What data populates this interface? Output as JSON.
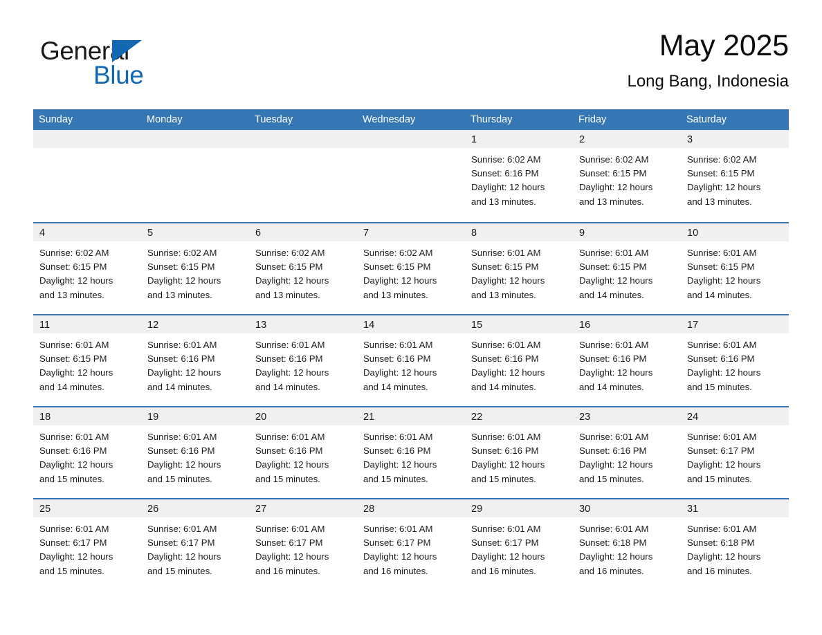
{
  "brand": {
    "name_part1": "General",
    "name_part2": "Blue",
    "triangle_color": "#1268b3",
    "text_color": "#1a1a1a"
  },
  "header": {
    "title": "May 2025",
    "subtitle": "Long Bang, Indonesia"
  },
  "theme": {
    "header_blue": "#3577b5",
    "band_gray": "#f0f0f0",
    "text": "#1a1a1a"
  },
  "calendar": {
    "weekdays": [
      "Sunday",
      "Monday",
      "Tuesday",
      "Wednesday",
      "Thursday",
      "Friday",
      "Saturday"
    ],
    "weeks": [
      [
        {
          "day": "",
          "sunrise": "",
          "sunset": "",
          "daylight_line1": "",
          "daylight_line2": ""
        },
        {
          "day": "",
          "sunrise": "",
          "sunset": "",
          "daylight_line1": "",
          "daylight_line2": ""
        },
        {
          "day": "",
          "sunrise": "",
          "sunset": "",
          "daylight_line1": "",
          "daylight_line2": ""
        },
        {
          "day": "",
          "sunrise": "",
          "sunset": "",
          "daylight_line1": "",
          "daylight_line2": ""
        },
        {
          "day": "1",
          "sunrise": "Sunrise: 6:02 AM",
          "sunset": "Sunset: 6:16 PM",
          "daylight_line1": "Daylight: 12 hours",
          "daylight_line2": "and 13 minutes."
        },
        {
          "day": "2",
          "sunrise": "Sunrise: 6:02 AM",
          "sunset": "Sunset: 6:15 PM",
          "daylight_line1": "Daylight: 12 hours",
          "daylight_line2": "and 13 minutes."
        },
        {
          "day": "3",
          "sunrise": "Sunrise: 6:02 AM",
          "sunset": "Sunset: 6:15 PM",
          "daylight_line1": "Daylight: 12 hours",
          "daylight_line2": "and 13 minutes."
        }
      ],
      [
        {
          "day": "4",
          "sunrise": "Sunrise: 6:02 AM",
          "sunset": "Sunset: 6:15 PM",
          "daylight_line1": "Daylight: 12 hours",
          "daylight_line2": "and 13 minutes."
        },
        {
          "day": "5",
          "sunrise": "Sunrise: 6:02 AM",
          "sunset": "Sunset: 6:15 PM",
          "daylight_line1": "Daylight: 12 hours",
          "daylight_line2": "and 13 minutes."
        },
        {
          "day": "6",
          "sunrise": "Sunrise: 6:02 AM",
          "sunset": "Sunset: 6:15 PM",
          "daylight_line1": "Daylight: 12 hours",
          "daylight_line2": "and 13 minutes."
        },
        {
          "day": "7",
          "sunrise": "Sunrise: 6:02 AM",
          "sunset": "Sunset: 6:15 PM",
          "daylight_line1": "Daylight: 12 hours",
          "daylight_line2": "and 13 minutes."
        },
        {
          "day": "8",
          "sunrise": "Sunrise: 6:01 AM",
          "sunset": "Sunset: 6:15 PM",
          "daylight_line1": "Daylight: 12 hours",
          "daylight_line2": "and 13 minutes."
        },
        {
          "day": "9",
          "sunrise": "Sunrise: 6:01 AM",
          "sunset": "Sunset: 6:15 PM",
          "daylight_line1": "Daylight: 12 hours",
          "daylight_line2": "and 14 minutes."
        },
        {
          "day": "10",
          "sunrise": "Sunrise: 6:01 AM",
          "sunset": "Sunset: 6:15 PM",
          "daylight_line1": "Daylight: 12 hours",
          "daylight_line2": "and 14 minutes."
        }
      ],
      [
        {
          "day": "11",
          "sunrise": "Sunrise: 6:01 AM",
          "sunset": "Sunset: 6:15 PM",
          "daylight_line1": "Daylight: 12 hours",
          "daylight_line2": "and 14 minutes."
        },
        {
          "day": "12",
          "sunrise": "Sunrise: 6:01 AM",
          "sunset": "Sunset: 6:16 PM",
          "daylight_line1": "Daylight: 12 hours",
          "daylight_line2": "and 14 minutes."
        },
        {
          "day": "13",
          "sunrise": "Sunrise: 6:01 AM",
          "sunset": "Sunset: 6:16 PM",
          "daylight_line1": "Daylight: 12 hours",
          "daylight_line2": "and 14 minutes."
        },
        {
          "day": "14",
          "sunrise": "Sunrise: 6:01 AM",
          "sunset": "Sunset: 6:16 PM",
          "daylight_line1": "Daylight: 12 hours",
          "daylight_line2": "and 14 minutes."
        },
        {
          "day": "15",
          "sunrise": "Sunrise: 6:01 AM",
          "sunset": "Sunset: 6:16 PM",
          "daylight_line1": "Daylight: 12 hours",
          "daylight_line2": "and 14 minutes."
        },
        {
          "day": "16",
          "sunrise": "Sunrise: 6:01 AM",
          "sunset": "Sunset: 6:16 PM",
          "daylight_line1": "Daylight: 12 hours",
          "daylight_line2": "and 14 minutes."
        },
        {
          "day": "17",
          "sunrise": "Sunrise: 6:01 AM",
          "sunset": "Sunset: 6:16 PM",
          "daylight_line1": "Daylight: 12 hours",
          "daylight_line2": "and 15 minutes."
        }
      ],
      [
        {
          "day": "18",
          "sunrise": "Sunrise: 6:01 AM",
          "sunset": "Sunset: 6:16 PM",
          "daylight_line1": "Daylight: 12 hours",
          "daylight_line2": "and 15 minutes."
        },
        {
          "day": "19",
          "sunrise": "Sunrise: 6:01 AM",
          "sunset": "Sunset: 6:16 PM",
          "daylight_line1": "Daylight: 12 hours",
          "daylight_line2": "and 15 minutes."
        },
        {
          "day": "20",
          "sunrise": "Sunrise: 6:01 AM",
          "sunset": "Sunset: 6:16 PM",
          "daylight_line1": "Daylight: 12 hours",
          "daylight_line2": "and 15 minutes."
        },
        {
          "day": "21",
          "sunrise": "Sunrise: 6:01 AM",
          "sunset": "Sunset: 6:16 PM",
          "daylight_line1": "Daylight: 12 hours",
          "daylight_line2": "and 15 minutes."
        },
        {
          "day": "22",
          "sunrise": "Sunrise: 6:01 AM",
          "sunset": "Sunset: 6:16 PM",
          "daylight_line1": "Daylight: 12 hours",
          "daylight_line2": "and 15 minutes."
        },
        {
          "day": "23",
          "sunrise": "Sunrise: 6:01 AM",
          "sunset": "Sunset: 6:16 PM",
          "daylight_line1": "Daylight: 12 hours",
          "daylight_line2": "and 15 minutes."
        },
        {
          "day": "24",
          "sunrise": "Sunrise: 6:01 AM",
          "sunset": "Sunset: 6:17 PM",
          "daylight_line1": "Daylight: 12 hours",
          "daylight_line2": "and 15 minutes."
        }
      ],
      [
        {
          "day": "25",
          "sunrise": "Sunrise: 6:01 AM",
          "sunset": "Sunset: 6:17 PM",
          "daylight_line1": "Daylight: 12 hours",
          "daylight_line2": "and 15 minutes."
        },
        {
          "day": "26",
          "sunrise": "Sunrise: 6:01 AM",
          "sunset": "Sunset: 6:17 PM",
          "daylight_line1": "Daylight: 12 hours",
          "daylight_line2": "and 15 minutes."
        },
        {
          "day": "27",
          "sunrise": "Sunrise: 6:01 AM",
          "sunset": "Sunset: 6:17 PM",
          "daylight_line1": "Daylight: 12 hours",
          "daylight_line2": "and 16 minutes."
        },
        {
          "day": "28",
          "sunrise": "Sunrise: 6:01 AM",
          "sunset": "Sunset: 6:17 PM",
          "daylight_line1": "Daylight: 12 hours",
          "daylight_line2": "and 16 minutes."
        },
        {
          "day": "29",
          "sunrise": "Sunrise: 6:01 AM",
          "sunset": "Sunset: 6:17 PM",
          "daylight_line1": "Daylight: 12 hours",
          "daylight_line2": "and 16 minutes."
        },
        {
          "day": "30",
          "sunrise": "Sunrise: 6:01 AM",
          "sunset": "Sunset: 6:18 PM",
          "daylight_line1": "Daylight: 12 hours",
          "daylight_line2": "and 16 minutes."
        },
        {
          "day": "31",
          "sunrise": "Sunrise: 6:01 AM",
          "sunset": "Sunset: 6:18 PM",
          "daylight_line1": "Daylight: 12 hours",
          "daylight_line2": "and 16 minutes."
        }
      ]
    ]
  }
}
